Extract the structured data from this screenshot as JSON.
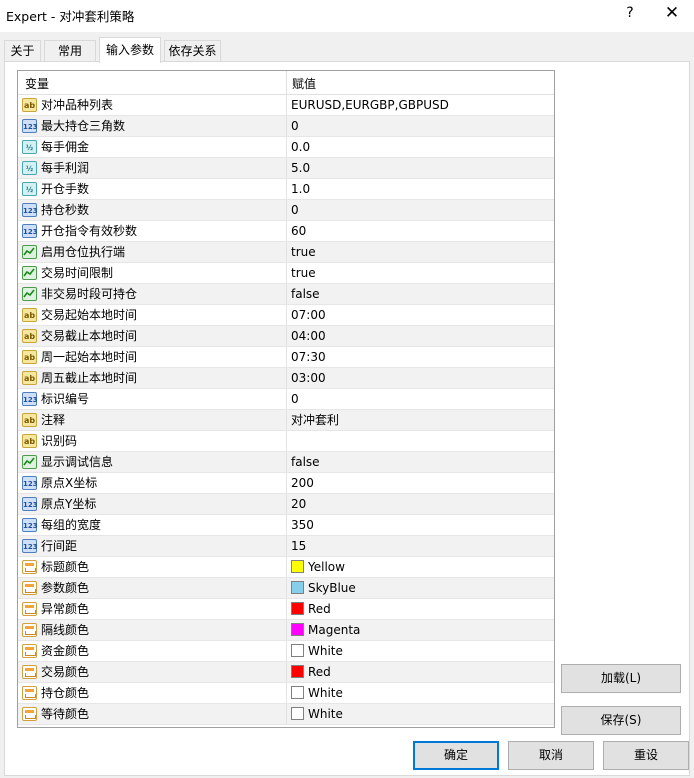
{
  "window": {
    "title": "Expert - 对冲套利策略",
    "help_glyph": "?",
    "close_glyph": "✕"
  },
  "tabs": [
    {
      "label": "关于",
      "active": false
    },
    {
      "label": "常用",
      "active": false
    },
    {
      "label": "输入参数",
      "active": true
    },
    {
      "label": "依存关系",
      "active": false
    }
  ],
  "grid": {
    "col_variable": "变量",
    "col_value": "赋值",
    "rows": [
      {
        "name": "对冲品种列表",
        "type": "ab",
        "value": "EURUSD,EURGBP,GBPUSD"
      },
      {
        "name": "最大持仓三角数",
        "type": "num",
        "value": "0"
      },
      {
        "name": "每手佣金",
        "type": "dbl",
        "value": "0.0"
      },
      {
        "name": "每手利润",
        "type": "dbl",
        "value": "5.0"
      },
      {
        "name": "开仓手数",
        "type": "dbl",
        "value": "1.0"
      },
      {
        "name": "持仓秒数",
        "type": "num",
        "value": "0"
      },
      {
        "name": "开仓指令有效秒数",
        "type": "num",
        "value": "60"
      },
      {
        "name": "启用仓位执行端",
        "type": "bool",
        "value": "true"
      },
      {
        "name": "交易时间限制",
        "type": "bool",
        "value": "true"
      },
      {
        "name": "非交易时段可持仓",
        "type": "bool",
        "value": "false"
      },
      {
        "name": "交易起始本地时间",
        "type": "ab",
        "value": "07:00"
      },
      {
        "name": "交易截止本地时间",
        "type": "ab",
        "value": "04:00"
      },
      {
        "name": "周一起始本地时间",
        "type": "ab",
        "value": "07:30"
      },
      {
        "name": "周五截止本地时间",
        "type": "ab",
        "value": "03:00"
      },
      {
        "name": "标识编号",
        "type": "num",
        "value": "0"
      },
      {
        "name": "注释",
        "type": "ab",
        "value": "对冲套利"
      },
      {
        "name": "识别码",
        "type": "ab",
        "value": ""
      },
      {
        "name": "显示调试信息",
        "type": "bool",
        "value": "false"
      },
      {
        "name": "原点X坐标",
        "type": "num",
        "value": "200"
      },
      {
        "name": "原点Y坐标",
        "type": "num",
        "value": "20"
      },
      {
        "name": "每组的宽度",
        "type": "num",
        "value": "350"
      },
      {
        "name": "行间距",
        "type": "num",
        "value": "15"
      },
      {
        "name": "标题颜色",
        "type": "clr",
        "value": "Yellow",
        "color": "#ffff00"
      },
      {
        "name": "参数颜色",
        "type": "clr",
        "value": "SkyBlue",
        "color": "#87ceeb"
      },
      {
        "name": "异常颜色",
        "type": "clr",
        "value": "Red",
        "color": "#ff0000"
      },
      {
        "name": "隔线颜色",
        "type": "clr",
        "value": "Magenta",
        "color": "#ff00ff"
      },
      {
        "name": "资金颜色",
        "type": "clr",
        "value": "White",
        "color": "#ffffff"
      },
      {
        "name": "交易颜色",
        "type": "clr",
        "value": "Red",
        "color": "#ff0000"
      },
      {
        "name": "持仓颜色",
        "type": "clr",
        "value": "White",
        "color": "#ffffff"
      },
      {
        "name": "等待颜色",
        "type": "clr",
        "value": "White",
        "color": "#ffffff"
      }
    ]
  },
  "type_icons": {
    "ab": "ab",
    "num": "123",
    "dbl": "½",
    "bool": "",
    "clr": ""
  },
  "buttons": {
    "load": "加载(L)",
    "save": "保存(S)",
    "ok": "确定",
    "cancel": "取消",
    "reset": "重设"
  }
}
